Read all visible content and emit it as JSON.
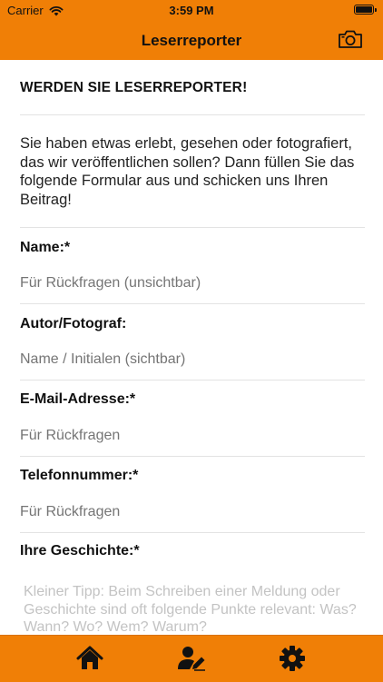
{
  "status": {
    "carrier": "Carrier",
    "time": "3:59 PM"
  },
  "nav": {
    "title": "Leserreporter",
    "camera_icon": "camera-icon"
  },
  "form": {
    "heading": "WERDEN SIE LESERREPORTER!",
    "intro": "Sie haben etwas erlebt, gesehen oder fotografiert, das wir veröffentlichen sollen? Dann füllen Sie das folgende Formular aus und schicken uns Ihren Beitrag!",
    "fields": [
      {
        "label": "Name:*",
        "placeholder": "Für Rückfragen (unsichtbar)"
      },
      {
        "label": "Autor/Fotograf:",
        "placeholder": "Name / Initialen (sichtbar)"
      },
      {
        "label": "E-Mail-Adresse:*",
        "placeholder": "Für Rückfragen"
      },
      {
        "label": "Telefonnummer:*",
        "placeholder": "Für Rückfragen"
      }
    ],
    "story_label": "Ihre Geschichte:*",
    "story_placeholder": "Kleiner Tipp: Beim Schreiben einer Meldung oder Geschichte sind oft folgende Punkte relevant: Was? Wann? Wo? Wem? Warum?"
  },
  "tabs": [
    {
      "icon": "home-icon"
    },
    {
      "icon": "user-edit-icon"
    },
    {
      "icon": "gear-icon"
    }
  ],
  "colors": {
    "accent": "#f07f06",
    "placeholder": "#c3c3c3"
  }
}
